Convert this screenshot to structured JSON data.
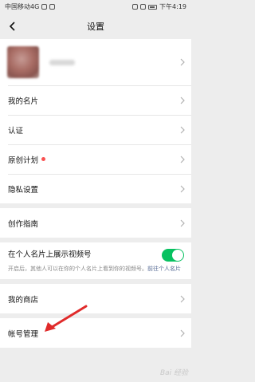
{
  "status_bar": {
    "carrier": "中国移动4G",
    "time": "下午4:19"
  },
  "header": {
    "title": "设置"
  },
  "groups": {
    "profile": {
      "card_label": "我的名片",
      "verify_label": "认证",
      "original_label": "原创计划",
      "privacy_label": "隐私设置"
    },
    "guide": {
      "label": "创作指南"
    },
    "channel": {
      "title": "在个人名片上展示视频号",
      "desc_prefix": "开启后，其他人可以在你的个人名片上看到你的视频号。",
      "desc_link": "前往个人名片",
      "toggle_state": "on"
    },
    "store": {
      "label": "我的商店"
    },
    "account": {
      "label": "帐号管理"
    }
  },
  "colors": {
    "accent_green": "#07c160",
    "badge_red": "#fa5151",
    "link_blue": "#576b95",
    "annotation_arrow": "#e02a2a"
  },
  "icons": [
    "back-icon",
    "chevron-right-icon",
    "battery-icon",
    "wifi-icon",
    "alarm-icon"
  ]
}
